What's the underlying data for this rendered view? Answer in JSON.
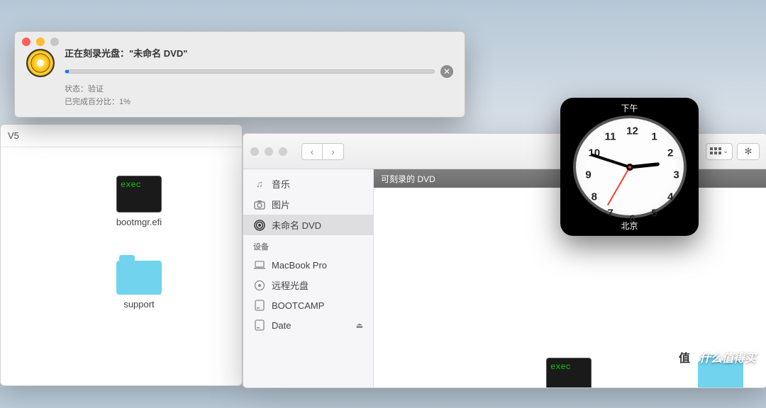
{
  "bg_window": {
    "title": "V5",
    "files": [
      {
        "name": "bootmgr.efi",
        "type": "exec"
      },
      {
        "name": "support",
        "type": "folder"
      }
    ]
  },
  "burn": {
    "title": "正在刻录光盘：\"未命名 DVD\"",
    "status_label": "状态：",
    "status_value": "验证",
    "progress_label": "已完成百分比：",
    "progress_value": "1%",
    "progress_percent": 1
  },
  "finder": {
    "sidebar": {
      "fav_items": [
        {
          "icon": "music",
          "label": "音乐"
        },
        {
          "icon": "photos",
          "label": "图片"
        },
        {
          "icon": "burn",
          "label": "未命名 DVD",
          "selected": true
        }
      ],
      "devices_header": "设备",
      "device_items": [
        {
          "icon": "laptop",
          "label": "MacBook Pro"
        },
        {
          "icon": "remote-disc",
          "label": "远程光盘"
        },
        {
          "icon": "hdd",
          "label": "BOOTCAMP"
        },
        {
          "icon": "hdd",
          "label": "Date",
          "eject": true
        }
      ]
    },
    "path_bar": "可刻录的 DVD",
    "content_items": [
      {
        "type": "exec",
        "name": ""
      },
      {
        "type": "folder",
        "name": ""
      }
    ]
  },
  "clock": {
    "top_label": "下午",
    "bottom_label": "北京",
    "hour": 2,
    "minute": 48,
    "second": 35
  },
  "watermark": {
    "badge": "值",
    "text": "什么值得买"
  }
}
